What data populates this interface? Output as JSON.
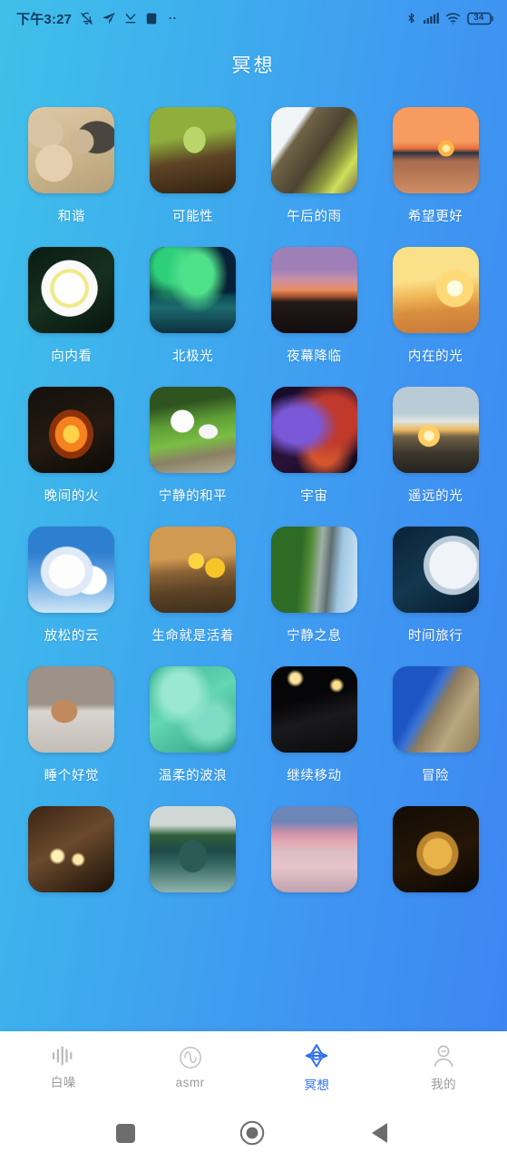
{
  "status_bar": {
    "time": "下午3:27",
    "battery_level": "34",
    "left_icons": [
      "bell-muted-icon",
      "paper-plane-icon",
      "download-check-icon",
      "square-app-icon",
      "more-dots-icon"
    ],
    "right_icons": [
      "bluetooth-icon",
      "cellular-signal-icon",
      "wifi-icon",
      "battery-icon"
    ]
  },
  "header": {
    "title": "冥想"
  },
  "theme": {
    "gradient_start": "#3fc0ea",
    "gradient_end": "#3d84f2",
    "accent": "#2f6ef0",
    "tab_inactive": "#9b9b9b",
    "tab_bar_bg": "#ffffff"
  },
  "grid": {
    "items": [
      {
        "label": "和谐",
        "art": "stones-sand"
      },
      {
        "label": "可能性",
        "art": "green-sprout"
      },
      {
        "label": "午后的雨",
        "art": "wet-leaves"
      },
      {
        "label": "希望更好",
        "art": "ocean-sunset"
      },
      {
        "label": "向内看",
        "art": "white-lotus"
      },
      {
        "label": "北极光",
        "art": "aurora"
      },
      {
        "label": "夜幕降临",
        "art": "dusk-sky"
      },
      {
        "label": "内在的光",
        "art": "sunrise-person"
      },
      {
        "label": "晚间的火",
        "art": "campfire"
      },
      {
        "label": "宁静的和平",
        "art": "white-doves"
      },
      {
        "label": "宇宙",
        "art": "nebula"
      },
      {
        "label": "遥远的光",
        "art": "distant-sunrise"
      },
      {
        "label": "放松的云",
        "art": "clouds"
      },
      {
        "label": "生命就是活着",
        "art": "mushrooms"
      },
      {
        "label": "宁静之息",
        "art": "tree-road"
      },
      {
        "label": "时间旅行",
        "art": "clock"
      },
      {
        "label": "睡个好觉",
        "art": "sleeping-cat"
      },
      {
        "label": "温柔的波浪",
        "art": "clear-water"
      },
      {
        "label": "继续移动",
        "art": "night-highway"
      },
      {
        "label": "冒险",
        "art": "rock-climber"
      },
      {
        "label": "",
        "art": "candles"
      },
      {
        "label": "",
        "art": "bridge-reflection"
      },
      {
        "label": "",
        "art": "boat-sunset"
      },
      {
        "label": "",
        "art": "buddha-statue"
      }
    ]
  },
  "tab_bar": {
    "tabs": [
      {
        "label": "白噪",
        "icon": "waveform-icon",
        "active": false
      },
      {
        "label": "asmr",
        "icon": "sine-circle-icon",
        "active": false
      },
      {
        "label": "冥想",
        "icon": "lotus-star-icon",
        "active": true
      },
      {
        "label": "我的",
        "icon": "person-icon",
        "active": false
      }
    ]
  },
  "android_nav": {
    "buttons": [
      {
        "name": "recents",
        "icon": "square-icon"
      },
      {
        "name": "home",
        "icon": "circle-icon"
      },
      {
        "name": "back",
        "icon": "triangle-left-icon"
      }
    ]
  }
}
